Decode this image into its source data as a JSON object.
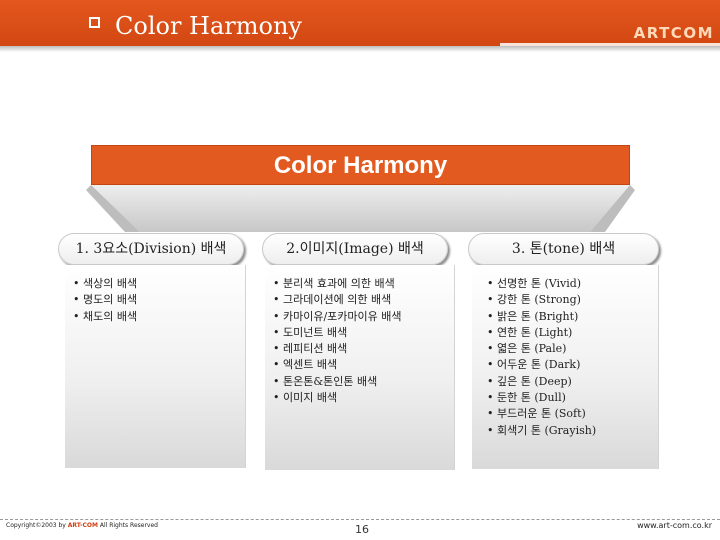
{
  "header": {
    "title": "Color Harmony",
    "brand": "ARTCOM",
    "colors": {
      "bar": "#d9501a",
      "brand_text": "#ffd9b8"
    }
  },
  "banner": {
    "title": "Color Harmony",
    "color": "#e35a20"
  },
  "columns": [
    {
      "heading": "1. 3요소(Division) 배색",
      "items": [
        "색상의 배색",
        "명도의 배색",
        "채도의 배색"
      ]
    },
    {
      "heading": "2.이미지(Image) 배색",
      "items": [
        "분리색 효과에 의한 배색",
        "그라데이션에 의한 배색",
        "카마이유/포카마이유 배색",
        "도미넌트 배색",
        "레피티션 배색",
        "엑센트 배색",
        "톤온톤&톤인톤 배색",
        "이미지 배색"
      ]
    },
    {
      "heading": "3. 톤(tone) 배색",
      "items": [
        "선명한 톤 (Vivid)",
        "강한 톤 (Strong)",
        "밝은 톤 (Bright)",
        "연한 톤 (Light)",
        "엷은 톤 (Pale)",
        "어두운 톤 (Dark)",
        "깊은 톤 (Deep)",
        "둔한 톤 (Dull)",
        "부드러운 톤 (Soft)",
        "회색기 톤 (Grayish)"
      ]
    }
  ],
  "footer": {
    "copyright_prefix": "Copyright©2003 by",
    "copyright_brand": "ART-COM",
    "copyright_suffix": "All Rights Reserved",
    "page_number": "16",
    "website": "www.art-com.co.kr"
  }
}
